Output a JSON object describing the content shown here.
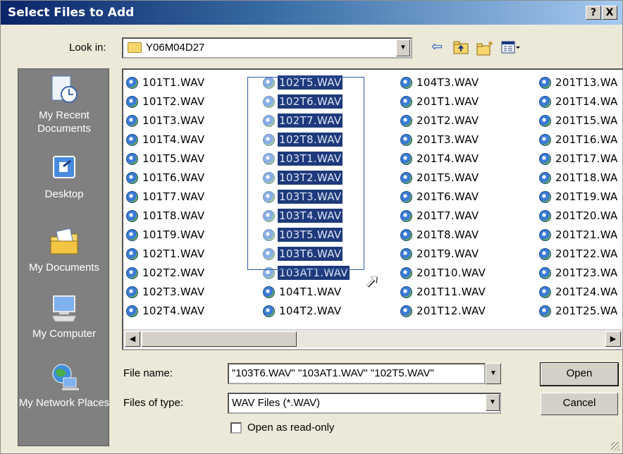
{
  "window": {
    "title": "Select Files to Add",
    "help_label": "?",
    "close_label": "X"
  },
  "lookin": {
    "label": "Look in:",
    "value": "Y06M04D27",
    "toolbar_icons": [
      "back-arrow-icon",
      "up-folder-icon",
      "new-folder-icon",
      "view-menu-icon"
    ]
  },
  "places": [
    {
      "name": "recent",
      "label": "My Recent Documents",
      "icon": "recent-documents-icon"
    },
    {
      "name": "desktop",
      "label": "Desktop",
      "icon": "desktop-icon"
    },
    {
      "name": "documents",
      "label": "My Documents",
      "icon": "my-documents-icon"
    },
    {
      "name": "computer",
      "label": "My Computer",
      "icon": "my-computer-icon"
    },
    {
      "name": "network",
      "label": "My Network Places",
      "icon": "network-places-icon"
    }
  ],
  "files": {
    "columns": [
      [
        "101T1.WAV",
        "101T2.WAV",
        "101T3.WAV",
        "101T4.WAV",
        "101T5.WAV",
        "101T6.WAV",
        "101T7.WAV",
        "101T8.WAV",
        "101T9.WAV",
        "102T1.WAV",
        "102T2.WAV",
        "102T3.WAV",
        "102T4.WAV"
      ],
      [
        "102T5.WAV",
        "102T6.WAV",
        "102T7.WAV",
        "102T8.WAV",
        "103T1.WAV",
        "103T2.WAV",
        "103T3.WAV",
        "103T4.WAV",
        "103T5.WAV",
        "103T6.WAV",
        "103AT1.WAV",
        "104T1.WAV",
        "104T2.WAV"
      ],
      [
        "104T3.WAV",
        "201T1.WAV",
        "201T2.WAV",
        "201T3.WAV",
        "201T4.WAV",
        "201T5.WAV",
        "201T6.WAV",
        "201T7.WAV",
        "201T8.WAV",
        "201T9.WAV",
        "201T10.WAV",
        "201T11.WAV",
        "201T12.WAV"
      ],
      [
        "201T13.WA",
        "201T14.WA",
        "201T15.WA",
        "201T16.WA",
        "201T17.WA",
        "201T18.WA",
        "201T19.WA",
        "201T20.WA",
        "201T21.WA",
        "201T22.WA",
        "201T23.WA",
        "201T24.WA",
        "201T25.WA"
      ]
    ],
    "selected": [
      "102T5.WAV",
      "102T6.WAV",
      "102T7.WAV",
      "102T8.WAV",
      "103T1.WAV",
      "103T2.WAV",
      "103T3.WAV",
      "103T4.WAV",
      "103T5.WAV",
      "103T6.WAV",
      "103AT1.WAV"
    ],
    "file_icon": "wav-file-icon"
  },
  "filename": {
    "label": "File name:",
    "value": "\"103T6.WAV\" \"103AT1.WAV\" \"102T5.WAV\""
  },
  "filetype": {
    "label": "Files of type:",
    "value": "WAV Files (*.WAV)"
  },
  "readonly": {
    "label": "Open as read-only",
    "checked": false
  },
  "buttons": {
    "open": "Open",
    "cancel": "Cancel"
  }
}
